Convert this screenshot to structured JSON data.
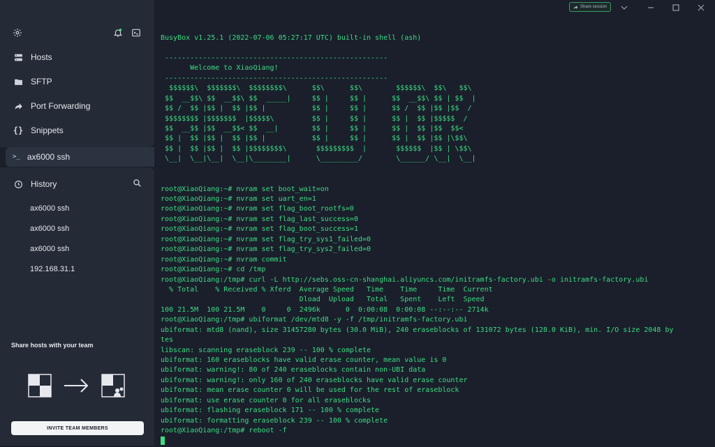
{
  "sidebar": {
    "nav": [
      {
        "label": "Hosts",
        "icon": "hosts-icon"
      },
      {
        "label": "SFTP",
        "icon": "folder-icon"
      },
      {
        "label": "Port Forwarding",
        "icon": "forward-icon"
      },
      {
        "label": "Snippets",
        "icon": "braces-icon"
      }
    ],
    "active_session": "ax6000 ssh",
    "history_title": "History",
    "history_items": [
      "ax6000 ssh",
      "ax6000 ssh",
      "ax6000 ssh",
      "192.168.31.1"
    ],
    "share_title": "Share hosts with your team",
    "invite_label": "INVITE TEAM MEMBERS"
  },
  "titlebar": {
    "share_session_label": "Share session"
  },
  "terminal": {
    "lines": [
      "BusyBox v1.25.1 (2022-07-06 05:27:17 UTC) built-in shell (ash)",
      "",
      " -----------------------------------------------------",
      "       Welcome to XiaoQiang!",
      " -----------------------------------------------------",
      "  $$$$$$\\  $$$$$$$\\  $$$$$$$$\\      $$\\      $$\\        $$$$$$\\  $$\\   $$\\",
      " $$  __$$\\ $$  __$$\\ $$  _____|     $$ |     $$ |      $$  __$$\\ $$ | $$  |",
      " $$ /  $$ |$$ |  $$ |$$ |           $$ |     $$ |      $$ /  $$ |$$ |$$  /",
      " $$$$$$$$ |$$$$$$$  |$$$$$\\         $$ |     $$ |      $$ |  $$ |$$$$$  /",
      " $$  __$$ |$$  __$$< $$  __|        $$ |     $$ |      $$ |  $$ |$$  $$<",
      " $$ |  $$ |$$ |  $$ |$$ |           $$ |     $$ |      $$ |  $$ |$$ |\\$$\\",
      " $$ |  $$ |$$ |  $$ |$$$$$$$$\\       $$$$$$$$$  |       $$$$$$  |$$ | \\$$\\",
      " \\__|  \\__|\\__|  \\__|\\________|      \\_________/        \\______/ \\__|  \\__|",
      "",
      "",
      "root@XiaoQiang:~# nvram set boot_wait=on",
      "root@XiaoQiang:~# nvram set uart_en=1",
      "root@XiaoQiang:~# nvram set flag_boot_rootfs=0",
      "root@XiaoQiang:~# nvram set flag_last_success=0",
      "root@XiaoQiang:~# nvram set flag_boot_success=1",
      "root@XiaoQiang:~# nvram set flag_try_sys1_failed=0",
      "root@XiaoQiang:~# nvram set flag_try_sys2_failed=0",
      "root@XiaoQiang:~# nvram commit",
      "root@XiaoQiang:~# cd /tmp",
      "root@XiaoQiang:/tmp# curl -L http://sebs.oss-cn-shanghai.aliyuncs.com/initramfs-factory.ubi -o initramfs-factory.ubi",
      "  % Total    % Received % Xferd  Average Speed   Time    Time     Time  Current",
      "                                 Dload  Upload   Total   Spent    Left  Speed",
      "100 21.5M  100 21.5M    0     0  2496k      0  0:00:08  0:00:08 --:--:-- 2714k",
      "root@XiaoQiang:/tmp# ubiformat /dev/mtd8 -y -f /tmp/initramfs-factory.ubi",
      "ubiformat: mtd8 (nand), size 31457280 bytes (30.0 MiB), 240 eraseblocks of 131072 bytes (128.0 KiB), min. I/O size 2048 by",
      "tes",
      "libscan: scanning eraseblock 239 -- 100 % complete",
      "ubiformat: 160 eraseblocks have valid erase counter, mean value is 0",
      "ubiformat: warning!: 80 of 240 eraseblocks contain non-UBI data",
      "ubiformat: warning!: only 160 of 240 eraseblocks have valid erase counter",
      "ubiformat: mean erase counter 0 will be used for the rest of eraseblock",
      "ubiformat: use erase counter 0 for all eraseblocks",
      "ubiformat: flashing eraseblock 171 -- 100 % complete",
      "ubiformat: formatting eraseblock 239 -- 100 % complete",
      "root@XiaoQiang:/tmp# reboot -f"
    ]
  },
  "colors": {
    "terminal_bg": "#1a1f2b",
    "terminal_fg": "#3ddc84",
    "sidebar_panel": "#242a36",
    "accent": "#3ddc84"
  }
}
